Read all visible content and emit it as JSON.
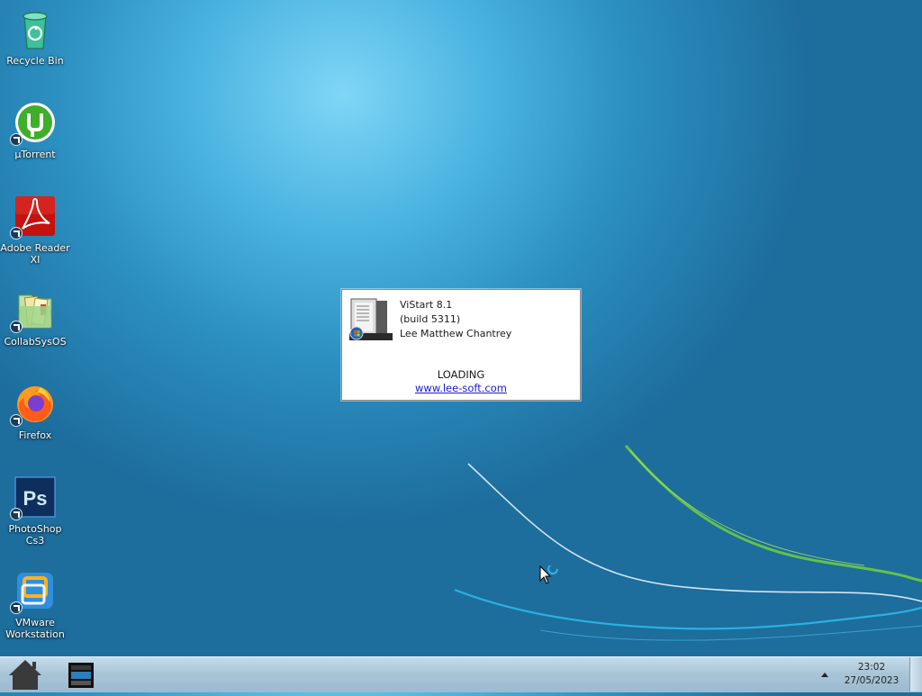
{
  "desktop": {
    "icons": [
      {
        "label": "Recycle Bin",
        "icon": "recycle-bin-icon"
      },
      {
        "label": "µTorrent",
        "icon": "utorrent-icon"
      },
      {
        "label": "Adobe Reader XI",
        "icon": "adobe-reader-icon"
      },
      {
        "label": "CollabSysOS",
        "icon": "folder-icon"
      },
      {
        "label": "Firefox",
        "icon": "firefox-icon"
      },
      {
        "label": "PhotoShop Cs3",
        "icon": "photoshop-icon"
      },
      {
        "label": "VMware Workstation",
        "icon": "vmware-icon"
      }
    ]
  },
  "dialog": {
    "name": "ViStart 8.1",
    "build": "(build 5311)",
    "author": "Lee Matthew Chantrey",
    "status": "LOADING",
    "link": "www.lee-soft.com"
  },
  "taskbar": {
    "start_icon": "home-icon",
    "pinned_icon": "file-explorer-icon",
    "tray_icon": "chevron-up-icon",
    "clock": {
      "time": "23:02",
      "date": "27/05/2023"
    }
  },
  "colors": {
    "desktop_light": "#7fd6f6",
    "desktop_dark": "#1d6d9d",
    "taskbar": "#a9c5d8",
    "link": "#1a1acc"
  }
}
